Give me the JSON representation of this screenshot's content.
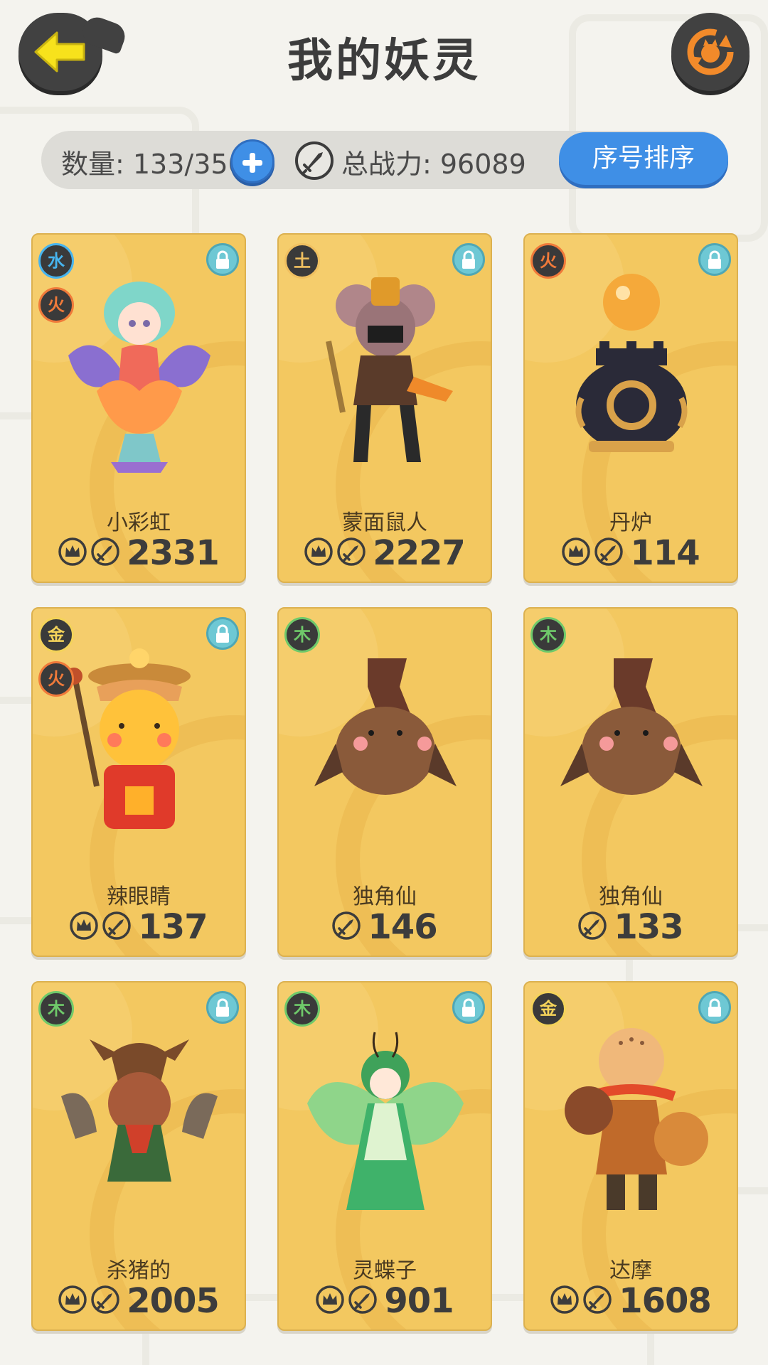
{
  "header": {
    "title": "我的妖灵",
    "back_icon": "back-arrow-icon",
    "refresh_icon": "refresh-icon"
  },
  "stats": {
    "count_label": "数量: 133/350",
    "total_power_label": "总战力: 96089",
    "sort_button": "序号排序"
  },
  "colors": {
    "card": "#f3c860",
    "accent_blue": "#3f8fe6",
    "dark": "#414141",
    "arrow_yellow": "#f7e21c",
    "refresh_orange": "#f28a2a"
  },
  "cards": [
    {
      "name": "小彩虹",
      "elements": [
        "水",
        "火"
      ],
      "locked": true,
      "crown": true,
      "power": "2331"
    },
    {
      "name": "蒙面鼠人",
      "elements": [
        "土"
      ],
      "locked": true,
      "crown": true,
      "power": "2227"
    },
    {
      "name": "丹炉",
      "elements": [
        "火"
      ],
      "locked": true,
      "crown": true,
      "power": "114"
    },
    {
      "name": "辣眼睛",
      "elements": [
        "金",
        "火"
      ],
      "locked": true,
      "crown": true,
      "power": "137"
    },
    {
      "name": "独角仙",
      "elements": [
        "木"
      ],
      "locked": false,
      "crown": false,
      "power": "146"
    },
    {
      "name": "独角仙",
      "elements": [
        "木"
      ],
      "locked": false,
      "crown": false,
      "power": "133"
    },
    {
      "name": "杀猪的",
      "elements": [
        "木"
      ],
      "locked": true,
      "crown": true,
      "power": "2005"
    },
    {
      "name": "灵蝶子",
      "elements": [
        "木"
      ],
      "locked": true,
      "crown": true,
      "power": "901"
    },
    {
      "name": "达摩",
      "elements": [
        "金"
      ],
      "locked": true,
      "crown": true,
      "power": "1608"
    }
  ]
}
